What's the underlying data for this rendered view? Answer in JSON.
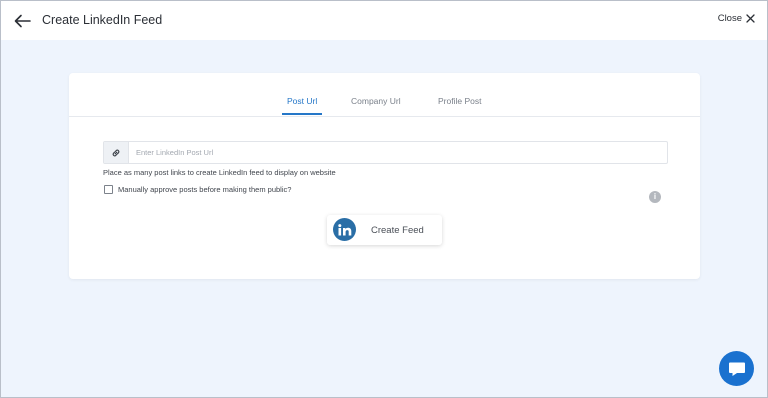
{
  "header": {
    "title": "Create LinkedIn Feed",
    "back_icon": "arrow-left-icon",
    "close_label": "Close",
    "close_icon": "close-x-icon"
  },
  "tabs": {
    "items": [
      {
        "label": "Post Url",
        "active": true
      },
      {
        "label": "Company Url",
        "active": false
      },
      {
        "label": "Profile Post",
        "active": false
      }
    ]
  },
  "form": {
    "link_icon": "link-icon",
    "url_placeholder": "Enter LinkedIn Post Url",
    "url_value": "",
    "helper_text": "Place as many post links to create LinkedIn feed to display on website",
    "approve_label": "Manually approve posts before making them public?",
    "approve_checked": false,
    "info_icon": "info-icon"
  },
  "actions": {
    "create_label": "Create Feed",
    "logo_text": "in"
  },
  "chat": {
    "icon": "chat-bubble-icon"
  },
  "colors": {
    "accent": "#2577c8",
    "background": "#eef4fd",
    "linkedin": "#2a6ea6",
    "chat": "#1a71cf"
  }
}
